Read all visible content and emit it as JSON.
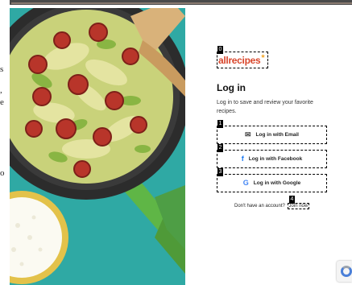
{
  "background_fragments": [
    "s",
    ",",
    "e",
    "o"
  ],
  "brand": {
    "logo_text": "allrecipes",
    "logo_mark": "★"
  },
  "login": {
    "title": "Log in",
    "subtitle": "Log in to save and review your favorite recipes.",
    "buttons": [
      {
        "label": "Log in with Email",
        "icon": "mail-icon",
        "glyph": "✉",
        "color": "#444444",
        "marker": "1"
      },
      {
        "label": "Log in with Facebook",
        "icon": "facebook-icon",
        "glyph": "f",
        "color": "#1877f2",
        "marker": "2"
      },
      {
        "label": "Log in with Google",
        "icon": "google-icon",
        "glyph": "G",
        "color": "#4285f4",
        "marker": "3"
      }
    ],
    "signup_prompt": "Don't have an account?",
    "signup_link": "Join now"
  },
  "markers": {
    "logo": "0",
    "join": "4"
  },
  "recaptcha": {
    "icon": "recaptcha-icon"
  },
  "colors": {
    "hero_bg": "#2fa9a4",
    "brand": "#d8462b",
    "brand_star": "#f3a72b"
  }
}
